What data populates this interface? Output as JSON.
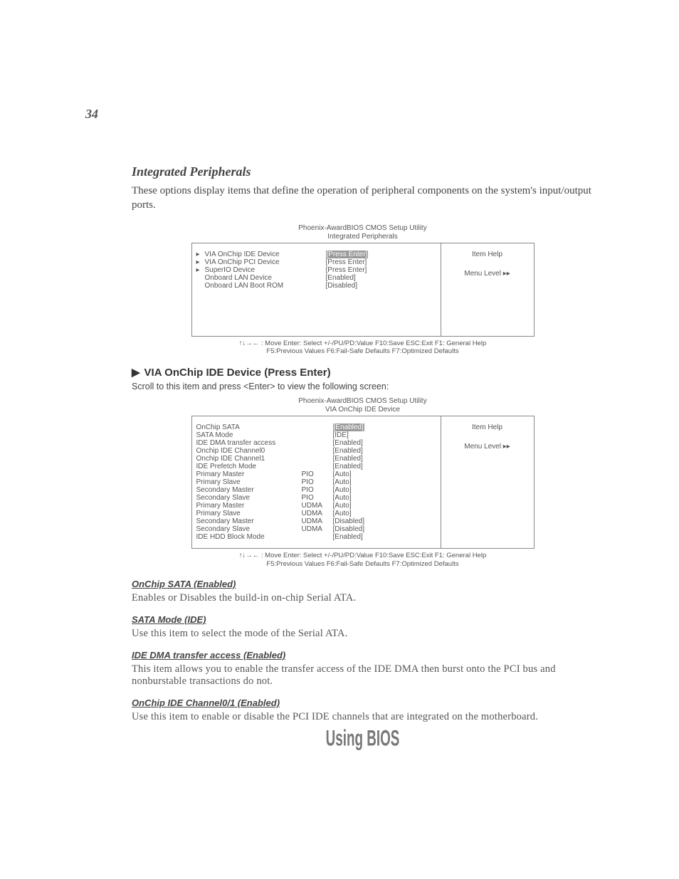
{
  "page_number": "34",
  "section": {
    "heading": "Integrated Peripherals",
    "intro": "These options display items that define the operation of peripheral components on the system's input/output ports."
  },
  "bios1": {
    "caption_line1": "Phoenix-AwardBIOS CMOS Setup Utility",
    "caption_line2": "Integrated Peripherals",
    "right_title": "Item Help",
    "right_level": "Menu Level   ▸▸",
    "rows": [
      {
        "arrow": "▸",
        "label": "VIA OnChip IDE Device",
        "value": "[Press Enter]",
        "highlight": true
      },
      {
        "arrow": "▸",
        "label": "VIA OnChip PCI Device",
        "value": "[Press Enter]"
      },
      {
        "arrow": "▸",
        "label": "SuperIO Device",
        "value": "[Press Enter]"
      },
      {
        "arrow": "",
        "label": "Onboard LAN Device",
        "value": "[Enabled]"
      },
      {
        "arrow": "",
        "label": "Onboard LAN Boot ROM",
        "value": "[Disabled]"
      }
    ],
    "footer_line1": "↑↓→← : Move  Enter: Select  +/-/PU/PD:Value  F10:Save  ESC:Exit  F1: General Help",
    "footer_line2": "F5:Previous Values       F6:Fail-Safe Defaults     F7:Optimized Defaults"
  },
  "sub": {
    "heading": "VIA OnChip IDE Device (Press Enter)",
    "instr": "Scroll to this item and press <Enter> to view the following screen:"
  },
  "bios2": {
    "caption_line1": "Phoenix-AwardBIOS CMOS Setup Utility",
    "caption_line2": "VIA OnChip IDE Device",
    "right_title": "Item Help",
    "right_level": "Menu Level   ▸▸",
    "rows": [
      {
        "label": "OnChip SATA",
        "sub": "",
        "value": "[Enabled]",
        "highlight": true
      },
      {
        "label": "SATA Mode",
        "sub": "",
        "value": "[IDE]"
      },
      {
        "label": "IDE DMA transfer access",
        "sub": "",
        "value": "[Enabled]"
      },
      {
        "label": "Onchip IDE Channel0",
        "sub": "",
        "value": "[Enabled]"
      },
      {
        "label": "Onchip IDE Channel1",
        "sub": "",
        "value": "[Enabled]"
      },
      {
        "label": "IDE Prefetch Mode",
        "sub": "",
        "value": "[Enabled]"
      },
      {
        "label": "Primary Master",
        "sub": "PIO",
        "value": "[Auto]"
      },
      {
        "label": "Primary Slave",
        "sub": "PIO",
        "value": "[Auto]"
      },
      {
        "label": "Secondary Master",
        "sub": "PIO",
        "value": "[Auto]"
      },
      {
        "label": "Secondary Slave",
        "sub": "PIO",
        "value": "[Auto]"
      },
      {
        "label": "Primary Master",
        "sub": "UDMA",
        "value": "[Auto]"
      },
      {
        "label": "Primary Slave",
        "sub": "UDMA",
        "value": "[Auto]"
      },
      {
        "label": "Secondary Master",
        "sub": "UDMA",
        "value": "[Disabled]"
      },
      {
        "label": "Secondary Slave",
        "sub": "UDMA",
        "value": "[Disabled]"
      },
      {
        "label": "IDE HDD Block Mode",
        "sub": "",
        "value": "[Enabled]"
      }
    ],
    "footer_line1": "↑↓→← : Move  Enter: Select  +/-/PU/PD:Value  F10:Save  ESC:Exit  F1: General Help",
    "footer_line2": "F5:Previous Values       F6:Fail-Safe Defaults     F7:Optimized Defaults"
  },
  "options": [
    {
      "heading": "OnChip SATA (Enabled)",
      "text": "Enables or Disables the build-in on-chip Serial ATA."
    },
    {
      "heading": "SATA Mode (IDE)",
      "text": "Use this item to select the mode of the Serial ATA."
    },
    {
      "heading": "IDE DMA transfer access (Enabled)",
      "text": "This item allows you to enable the transfer access of the IDE DMA then burst onto the PCI bus and nonburstable transactions do not."
    },
    {
      "heading": "OnChip IDE Channel0/1 (Enabled)",
      "text": "Use this item to enable or disable the PCI IDE channels that are integrated on the motherboard."
    }
  ],
  "footer_brand": "Using BIOS"
}
